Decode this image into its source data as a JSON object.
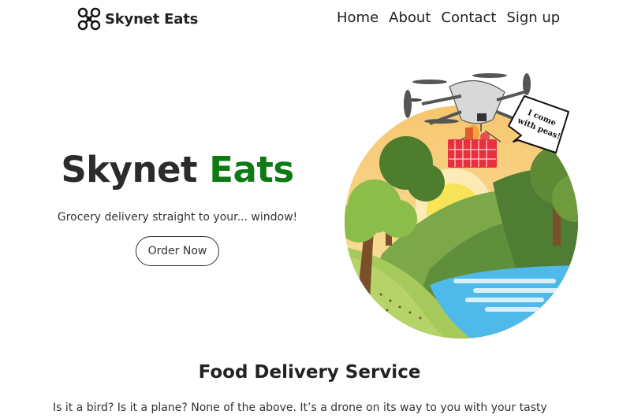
{
  "nav": {
    "brand_icon": "drone-icon",
    "brand_name": "Skynet Eats",
    "links": [
      "Home",
      "About",
      "Contact",
      "Sign up"
    ]
  },
  "hero": {
    "title_part1": "Skynet",
    "title_part2": "Eats",
    "accent_color": "#0d7a12",
    "subtitle": "Grocery delivery straight to your... window!",
    "cta_label": "Order Now",
    "speech_bubble": [
      "I come",
      "with peas!"
    ]
  },
  "section": {
    "title": "Food Delivery Service",
    "text": "Is it a bird? Is it a plane? None of the above. It’s a drone on its way to you with your tasty"
  }
}
